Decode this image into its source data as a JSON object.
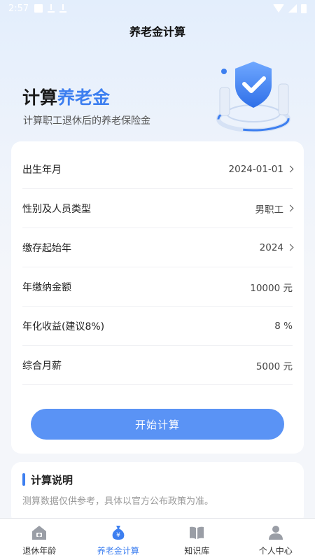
{
  "status_bar": {
    "time": "2:57"
  },
  "nav": {
    "title": "养老金计算"
  },
  "hero": {
    "title_prefix": "计算",
    "title_accent": "养老金",
    "subtitle": "计算职工退休后的养老保险金"
  },
  "form": {
    "rows": [
      {
        "label": "出生年月",
        "value": "2024-01-01",
        "has_chevron": true
      },
      {
        "label": "性别及人员类型",
        "value": "男职工",
        "has_chevron": true
      },
      {
        "label": "缴存起始年",
        "value": "2024",
        "has_chevron": true
      },
      {
        "label": "年缴纳金额",
        "value": "10000 元",
        "has_chevron": false
      },
      {
        "label": "年化收益(建议8%)",
        "value": "8 %",
        "has_chevron": false
      },
      {
        "label": "综合月薪",
        "value": "5000 元",
        "has_chevron": false
      }
    ],
    "submit_label": "开始计算"
  },
  "notes": {
    "title": "计算说明",
    "text": "测算数据仅供参考，具体以官方公布政策为准。"
  },
  "tabbar": {
    "tabs": [
      {
        "label": "退休年龄",
        "icon": "house-icon",
        "active": false
      },
      {
        "label": "养老金计算",
        "icon": "money-bag-icon",
        "active": true
      },
      {
        "label": "知识库",
        "icon": "book-icon",
        "active": false
      },
      {
        "label": "个人中心",
        "icon": "person-icon",
        "active": false
      }
    ]
  },
  "colors": {
    "accent": "#3d7ff0",
    "button": "#5a93f5",
    "inactive_icon": "#9a9ea6"
  }
}
